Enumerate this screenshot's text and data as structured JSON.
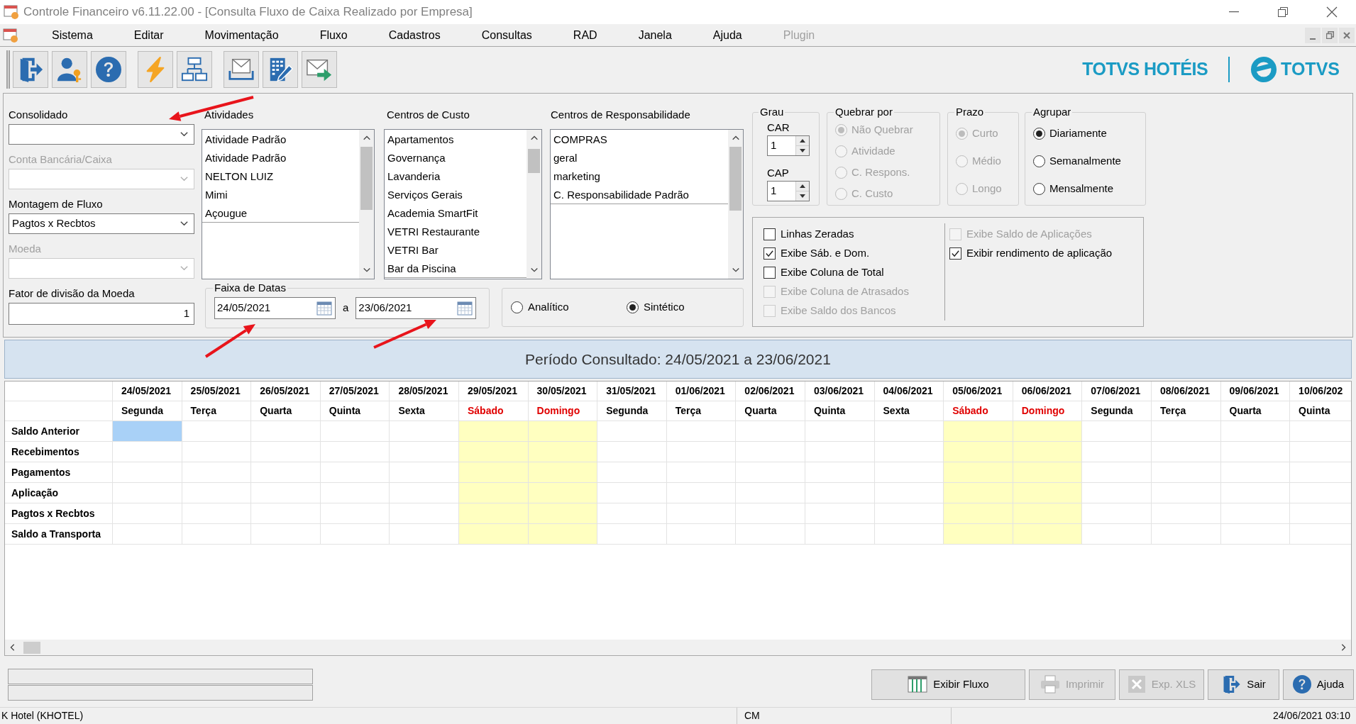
{
  "window": {
    "title": "Controle Financeiro v6.11.22.00 - [Consulta Fluxo de Caixa Realizado por Empresa]"
  },
  "menu": [
    {
      "label": "Sistema",
      "disabled": false
    },
    {
      "label": "Editar",
      "disabled": false
    },
    {
      "label": "Movimentação",
      "disabled": false
    },
    {
      "label": "Fluxo",
      "disabled": false
    },
    {
      "label": "Cadastros",
      "disabled": false
    },
    {
      "label": "Consultas",
      "disabled": false
    },
    {
      "label": "RAD",
      "disabled": false
    },
    {
      "label": "Janela",
      "disabled": false
    },
    {
      "label": "Ajuda",
      "disabled": false
    },
    {
      "label": "Plugin",
      "disabled": true
    }
  ],
  "brand": {
    "product": "TOTVS HOTÉIS",
    "logo": "TOTVS"
  },
  "filters": {
    "fields": [
      {
        "kind": "combo",
        "label": "Consolidado",
        "disabled": false
      },
      {
        "kind": "combo",
        "label": "Conta Bancária/Caixa",
        "disabled": true
      },
      {
        "kind": "combo",
        "label": "Montagem de Fluxo",
        "value": "Pagtos x Recbtos",
        "disabled": false
      },
      {
        "kind": "combo",
        "label": "Moeda",
        "disabled": true
      },
      {
        "kind": "input",
        "label": "Fator de divisão da Moeda",
        "value": "1",
        "disabled": false
      }
    ],
    "lists": [
      {
        "label": "Atividades",
        "items": [
          {
            "label": "Atividade Padrão",
            "selected": false
          },
          {
            "label": "Atividade Padrão",
            "selected": false
          },
          {
            "label": "NELTON LUIZ",
            "selected": false
          },
          {
            "label": "Mimi",
            "selected": false
          },
          {
            "label": "Açougue",
            "selected": false
          }
        ]
      },
      {
        "label": "Centros de Custo",
        "items": [
          {
            "label": "Apartamentos",
            "selected": false
          },
          {
            "label": "Governança",
            "selected": false
          },
          {
            "label": "Lavanderia",
            "selected": false
          },
          {
            "label": "Serviços Gerais",
            "selected": false
          },
          {
            "label": "Academia SmartFit",
            "selected": false
          },
          {
            "label": "VETRI Restaurante",
            "selected": false
          },
          {
            "label": "VETRI Bar",
            "selected": false
          },
          {
            "label": "Bar da Piscina",
            "selected": false
          }
        ]
      },
      {
        "label": "Centros de Responsabilidade",
        "items": [
          {
            "label": "COMPRAS",
            "selected": false
          },
          {
            "label": "geral",
            "selected": false
          },
          {
            "label": "marketing",
            "selected": false
          },
          {
            "label": "C. Responsabilidade Padrão",
            "selected": false
          }
        ]
      }
    ],
    "date_range": {
      "label": "Faixa de Datas",
      "from": "24/05/2021",
      "separator": "a",
      "to": "23/06/2021"
    },
    "view_mode": [
      {
        "label": "Analítico",
        "selected": false
      },
      {
        "label": "Sintético",
        "selected": true
      }
    ],
    "grau": {
      "label": "Grau",
      "spinners": [
        {
          "label": "CAR",
          "value": "1"
        },
        {
          "label": "CAP",
          "value": "1"
        }
      ]
    },
    "radio_groups": [
      {
        "label": "Quebrar por",
        "options": [
          {
            "label": "Não Quebrar",
            "selected": true,
            "disabled": true
          },
          {
            "label": "Atividade",
            "selected": false,
            "disabled": true
          },
          {
            "label": "C. Respons.",
            "selected": false,
            "disabled": true
          },
          {
            "label": "C. Custo",
            "selected": false,
            "disabled": true
          }
        ]
      },
      {
        "label": "Prazo",
        "options": [
          {
            "label": "Curto",
            "selected": true,
            "disabled": true
          },
          {
            "label": "Médio",
            "selected": false,
            "disabled": true
          },
          {
            "label": "Longo",
            "selected": false,
            "disabled": true
          }
        ]
      },
      {
        "label": "Agrupar",
        "options": [
          {
            "label": "Diariamente",
            "selected": true,
            "disabled": false
          },
          {
            "label": "Semanalmente",
            "selected": false,
            "disabled": false
          },
          {
            "label": "Mensalmente",
            "selected": false,
            "disabled": false
          }
        ]
      }
    ],
    "options": {
      "left": [
        {
          "label": "Linhas Zeradas",
          "checked": false,
          "disabled": false
        },
        {
          "label": "Exibe Sáb. e Dom.",
          "checked": true,
          "disabled": false
        },
        {
          "label": "Exibe Coluna de Total",
          "checked": false,
          "disabled": false
        },
        {
          "label": "Exibe Coluna de Atrasados",
          "checked": false,
          "disabled": true
        },
        {
          "label": "Exibe Saldo dos Bancos",
          "checked": false,
          "disabled": true
        }
      ],
      "right": [
        {
          "label": "Exibe Saldo de Aplicações",
          "checked": false,
          "disabled": true
        },
        {
          "label": "Exibir rendimento de aplicação",
          "checked": true,
          "disabled": false
        }
      ]
    }
  },
  "period": {
    "title": "Período Consultado: 24/05/2021 a 23/06/2021"
  },
  "grid": {
    "columns": [
      {
        "date": "24/05/2021",
        "weekday": "Segunda",
        "weekend": false,
        "selected": true
      },
      {
        "date": "25/05/2021",
        "weekday": "Terça",
        "weekend": false,
        "selected": false
      },
      {
        "date": "26/05/2021",
        "weekday": "Quarta",
        "weekend": false,
        "selected": false
      },
      {
        "date": "27/05/2021",
        "weekday": "Quinta",
        "weekend": false,
        "selected": false
      },
      {
        "date": "28/05/2021",
        "weekday": "Sexta",
        "weekend": false,
        "selected": false
      },
      {
        "date": "29/05/2021",
        "weekday": "Sábado",
        "weekend": true,
        "selected": false
      },
      {
        "date": "30/05/2021",
        "weekday": "Domingo",
        "weekend": true,
        "selected": false
      },
      {
        "date": "31/05/2021",
        "weekday": "Segunda",
        "weekend": false,
        "selected": false
      },
      {
        "date": "01/06/2021",
        "weekday": "Terça",
        "weekend": false,
        "selected": false
      },
      {
        "date": "02/06/2021",
        "weekday": "Quarta",
        "weekend": false,
        "selected": false
      },
      {
        "date": "03/06/2021",
        "weekday": "Quinta",
        "weekend": false,
        "selected": false
      },
      {
        "date": "04/06/2021",
        "weekday": "Sexta",
        "weekend": false,
        "selected": false
      },
      {
        "date": "05/06/2021",
        "weekday": "Sábado",
        "weekend": true,
        "selected": false
      },
      {
        "date": "06/06/2021",
        "weekday": "Domingo",
        "weekend": true,
        "selected": false
      },
      {
        "date": "07/06/2021",
        "weekday": "Segunda",
        "weekend": false,
        "selected": false
      },
      {
        "date": "08/06/2021",
        "weekday": "Terça",
        "weekend": false,
        "selected": false
      },
      {
        "date": "09/06/2021",
        "weekday": "Quarta",
        "weekend": false,
        "selected": false
      },
      {
        "date": "10/06/202",
        "weekday": "Quinta",
        "weekend": false,
        "selected": false
      }
    ],
    "rows": [
      {
        "label": "Saldo Anterior",
        "selected": true
      },
      {
        "label": "Recebimentos",
        "selected": false
      },
      {
        "label": "Pagamentos",
        "selected": false
      },
      {
        "label": "Aplicação",
        "selected": false
      },
      {
        "label": "Pagtos x Recbtos",
        "selected": false
      },
      {
        "label": "Saldo a Transporta",
        "selected": false
      }
    ]
  },
  "buttons": [
    {
      "kind": "grid",
      "label": "Exibir Fluxo",
      "disabled": false
    },
    {
      "kind": "printer",
      "label": "Imprimir",
      "disabled": true
    },
    {
      "kind": "excel",
      "label": "Exp. XLS",
      "disabled": true
    },
    {
      "kind": "exit",
      "label": "Sair",
      "disabled": false
    },
    {
      "kind": "help",
      "label": "Ajuda",
      "disabled": false
    }
  ],
  "status_bar": [
    "K Hotel (KHOTEL)",
    "CM",
    "24/06/2021 03:10"
  ]
}
